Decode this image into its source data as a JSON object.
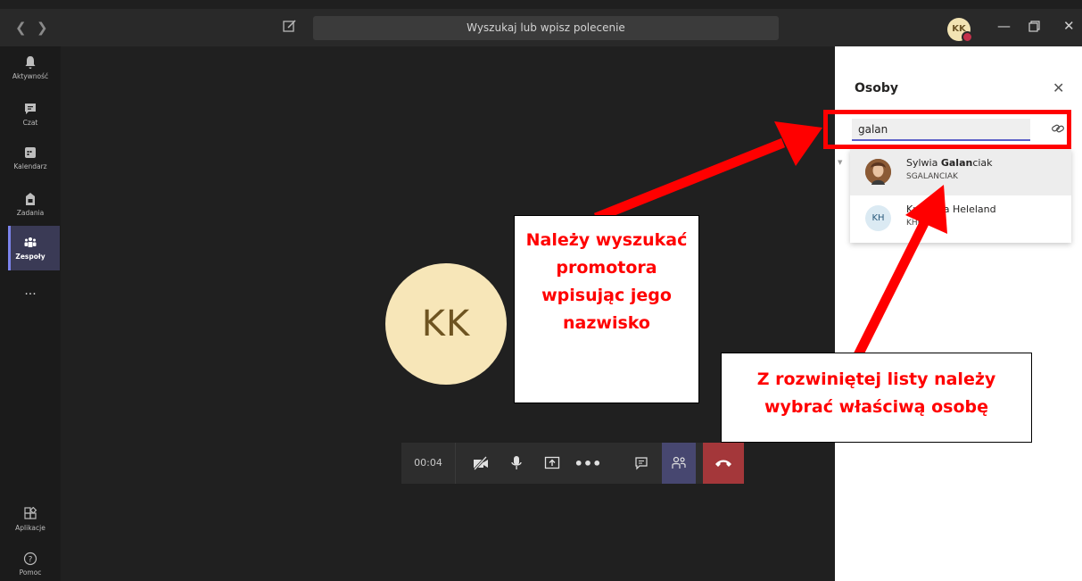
{
  "app": {
    "search_placeholder": "Wyszukaj lub wpisz polecenie",
    "user_initials": "KK"
  },
  "rail": {
    "items": [
      {
        "label": "Aktywność",
        "icon": "bell-icon"
      },
      {
        "label": "Czat",
        "icon": "chat-icon"
      },
      {
        "label": "Kalendarz",
        "icon": "calendar-icon"
      },
      {
        "label": "Zadania",
        "icon": "assignments-icon"
      },
      {
        "label": "Zespoły",
        "icon": "teams-icon",
        "active": true
      },
      {
        "label": "...",
        "icon": "more-icon"
      }
    ],
    "bottom": [
      {
        "label": "Aplikacje",
        "icon": "apps-icon"
      },
      {
        "label": "Pomoc",
        "icon": "help-icon"
      }
    ]
  },
  "call": {
    "participant_initials": "KK",
    "timer": "00:04"
  },
  "people_panel": {
    "title": "Osoby",
    "search_value": "galan",
    "results": [
      {
        "name_before": "Sylwia ",
        "name_match": "Galan",
        "name_after": "ciak",
        "sub": "SGALANCIAK",
        "highlighted": true
      },
      {
        "name_before": "Krystyna Heleland",
        "name_match": "",
        "name_after": "",
        "sub": "KHELAND",
        "initials": "KH",
        "highlighted": false
      }
    ]
  },
  "annotations": {
    "callout_search": "Należy wyszukać promotora wpisując jego nazwisko",
    "callout_select": "Z rozwiniętej listy należy wybrać właściwą osobę",
    "color": "#ff0000"
  }
}
